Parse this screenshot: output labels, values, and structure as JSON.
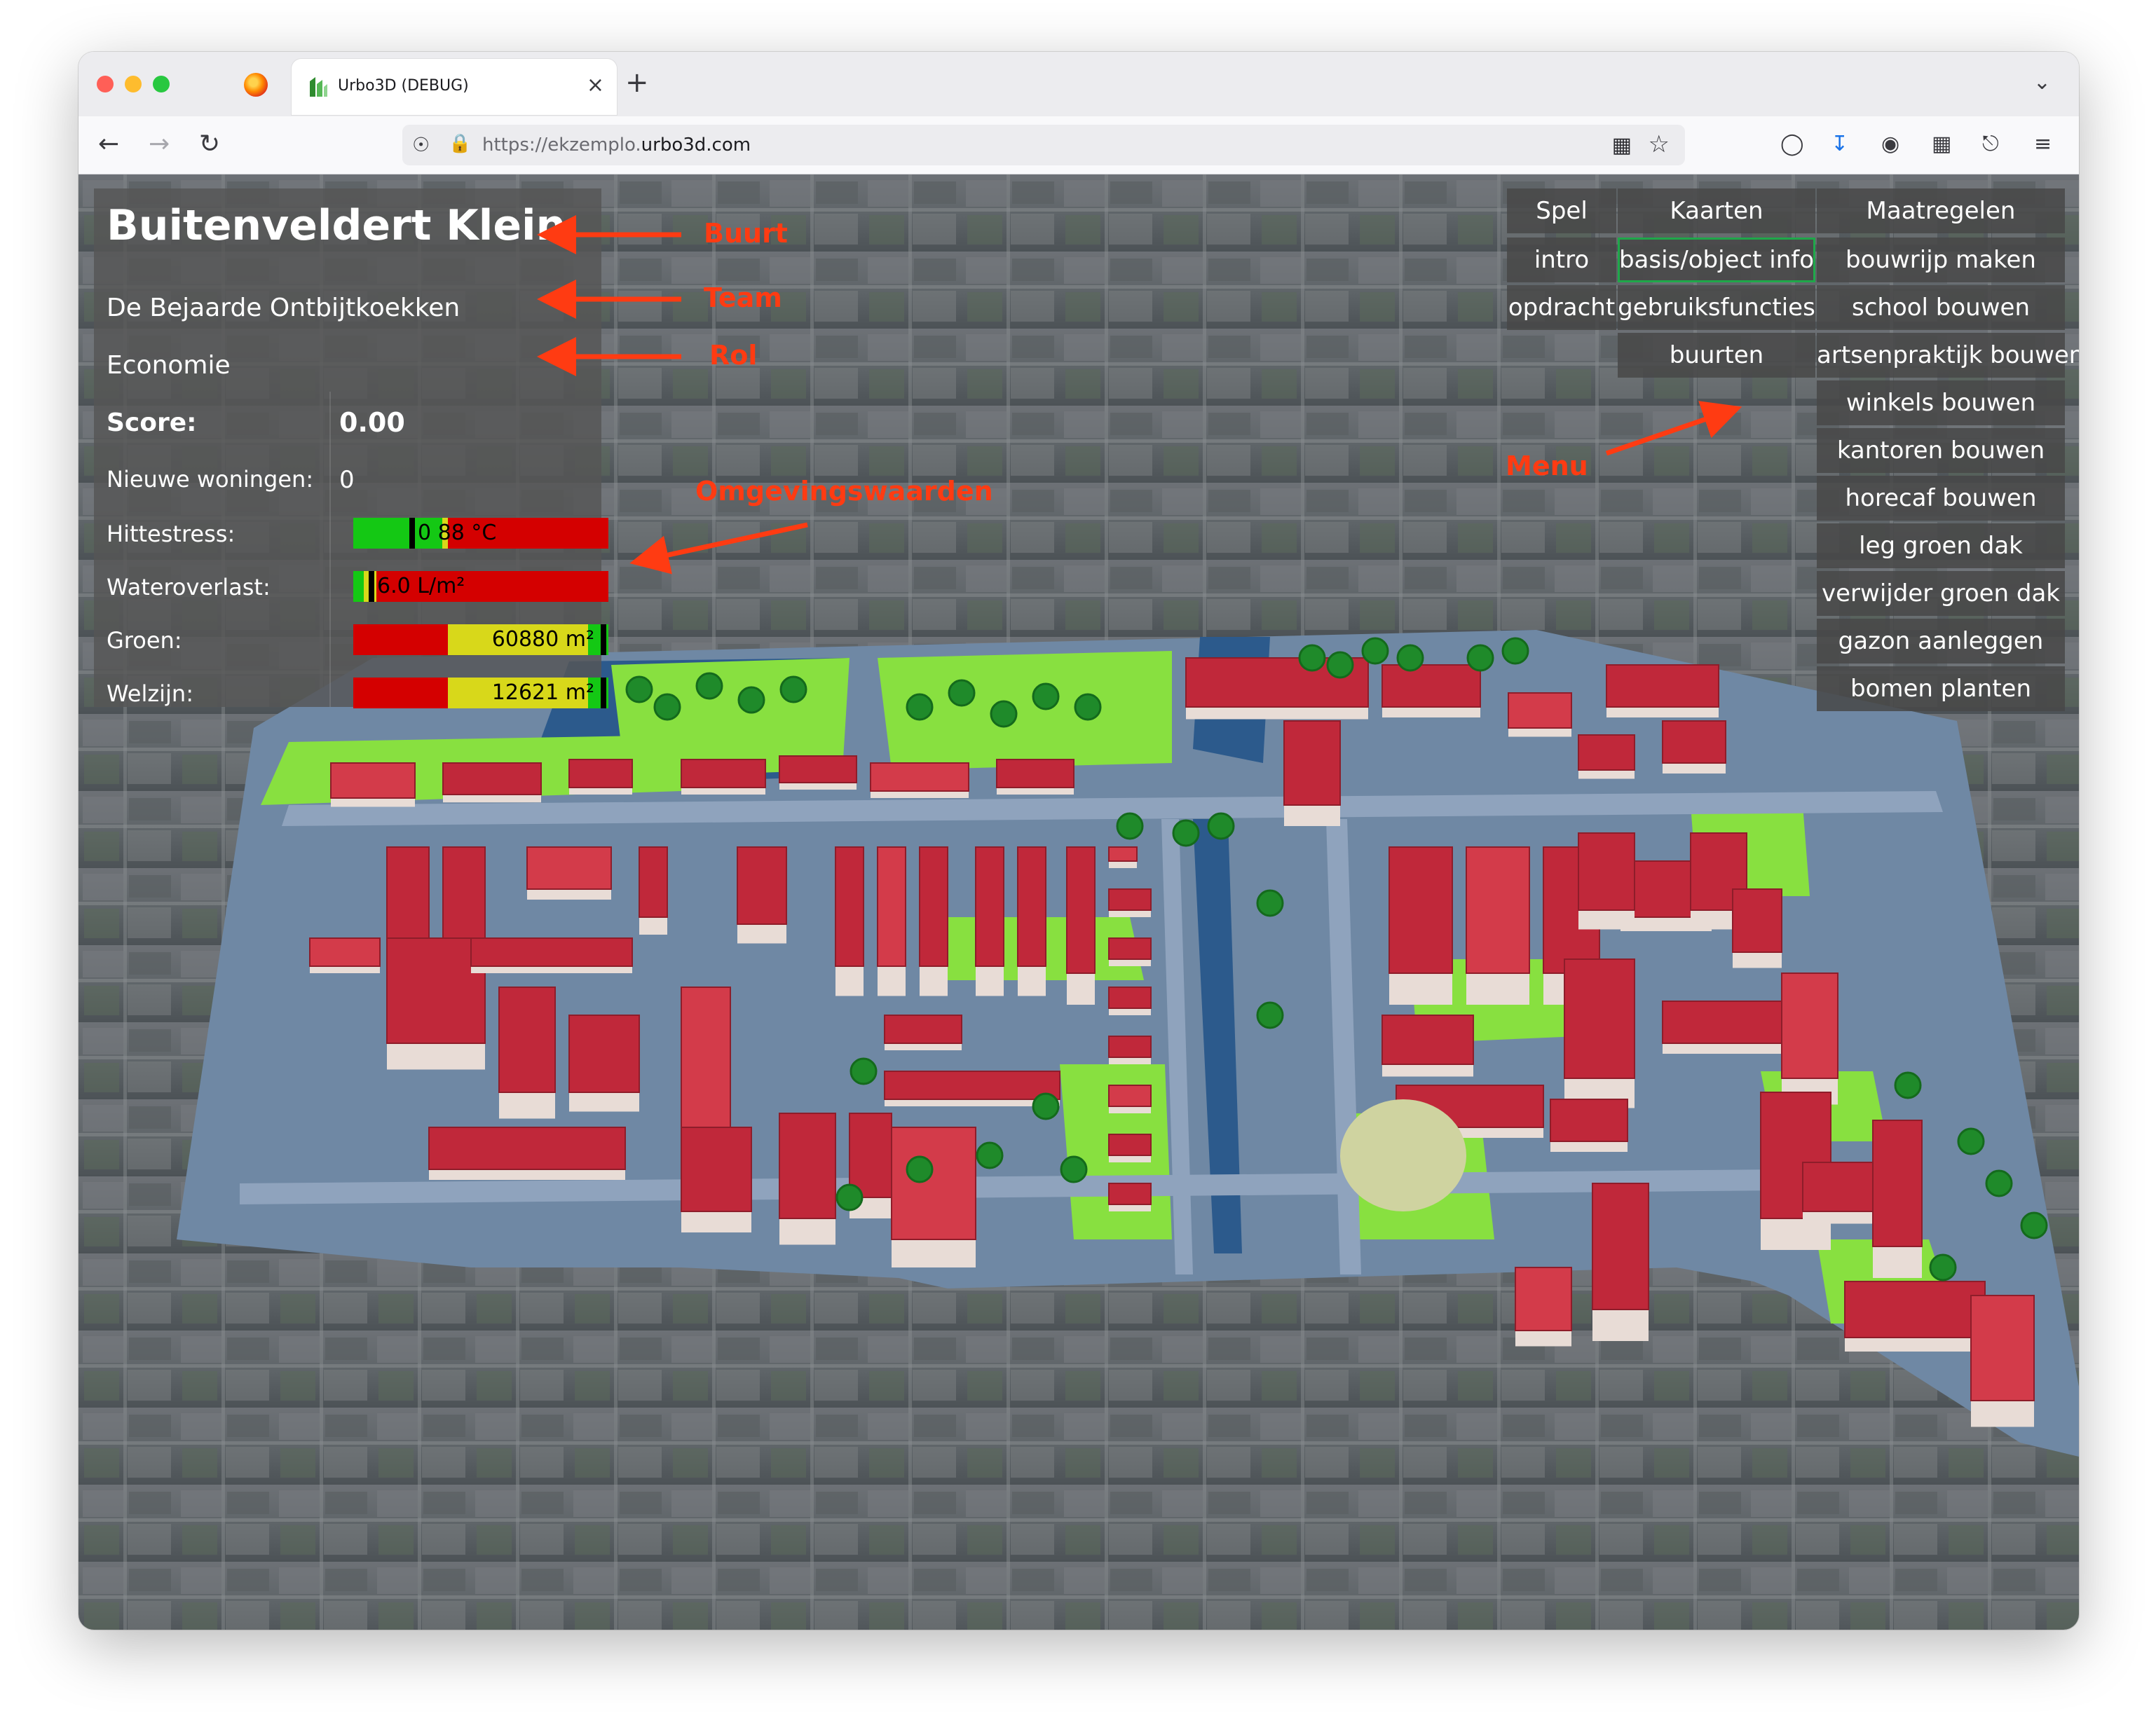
{
  "browser": {
    "tab_title": "Urbo3D (DEBUG)",
    "new_tab_label": "+",
    "close_tab_label": "×",
    "url_prefix": "https://ekzemplo.",
    "url_domain": "urbo3d.com",
    "icons": [
      "firefox-icon",
      "back-icon",
      "forward-icon",
      "reload-icon",
      "shield-icon",
      "lock-icon",
      "extensions-grid-icon",
      "bookmark-star-icon",
      "pocket-icon",
      "download-icon",
      "profile-icon",
      "apps-icon",
      "extension-icon",
      "hamburger-menu-icon",
      "tab-list-chevron-icon"
    ]
  },
  "info_panel": {
    "neighbourhood": "Buitenveldert Klein",
    "team": "De Bejaarde Ontbijtkoekken",
    "role": "Economie",
    "score_label": "Score:",
    "score_value": "0.00",
    "new_houses_label": "Nieuwe woningen:",
    "new_houses_value": "0",
    "heat_label": "Hittestress:",
    "heat_text": "0 88 °C",
    "heat_level": 0.22,
    "water_label": "Wateroverlast:",
    "water_text": "6.0 L/m²",
    "water_level": 0.06,
    "green_label": "Groen:",
    "green_text": "60880 m²",
    "green_level": 0.97,
    "welfare_label": "Welzijn:",
    "welfare_text": "12621 m²",
    "welfare_level": 0.97
  },
  "menu": {
    "spel": {
      "header": "Spel",
      "items": [
        "intro",
        "opdracht"
      ]
    },
    "kaarten": {
      "header": "Kaarten",
      "items": [
        "basis/object info",
        "gebruiksfuncties",
        "buurten"
      ],
      "selected": "basis/object info"
    },
    "maatregelen": {
      "header": "Maatregelen",
      "items": [
        "bouwrijp maken",
        "school bouwen",
        "artsenpraktijk bouwen",
        "winkels bouwen",
        "kantoren bouwen",
        "horecaf bouwen",
        "leg groen dak",
        "verwijder groen dak",
        "gazon aanleggen",
        "bomen planten"
      ]
    }
  },
  "annotations": {
    "buurt": "Buurt",
    "team": "Team",
    "rol": "Rol",
    "omgevingswaarden": "Omgevingswaarden",
    "menu": "Menu"
  },
  "colors": {
    "accent_selected": "#1fa84a",
    "annotation": "#ff3b12",
    "bar_green": "#14c814",
    "bar_yellow": "#d8d81a",
    "bar_red": "#d40000",
    "roof_red": "#c0283a",
    "grass": "#88e040",
    "water": "#2c5a8c",
    "road": "#7f93ad"
  }
}
